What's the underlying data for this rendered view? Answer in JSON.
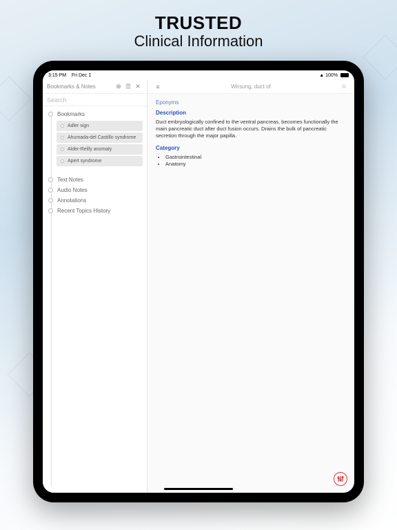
{
  "promo": {
    "line1": "TRUSTED",
    "line2": "Clinical Information"
  },
  "statusbar": {
    "time": "3:15 PM",
    "date": "Fri Dec 1",
    "battery": "100%",
    "wifi": "wifi-icon"
  },
  "sidebar": {
    "title": "Bookmarks & Notes",
    "icons": {
      "add": "plus-circle-icon",
      "sort": "filter-icon",
      "close": "close-icon"
    },
    "search_placeholder": "Search",
    "sections": {
      "bookmarks": {
        "label": "Bookmarks",
        "items": [
          {
            "label": "Adler sign"
          },
          {
            "label": "Ahumada-del Castillo syndrome"
          },
          {
            "label": "Alder-Reilly anomaly"
          },
          {
            "label": "Apert syndrome"
          }
        ]
      },
      "text_notes": {
        "label": "Text Notes"
      },
      "audio_notes": {
        "label": "Audio Notes"
      },
      "annotations": {
        "label": "Annotations"
      },
      "history": {
        "label": "Recent Topics History"
      }
    }
  },
  "main": {
    "toolbar": {
      "left_icon": "list-icon",
      "title": "Wirsung, duct of",
      "right_icon": "star-outline-icon"
    },
    "breadcrumb": "Eponyms",
    "description_heading": "Description",
    "description_body": "Duct embryologically confined to the ventral pancreas, becomes functionally the main pancreatic duct after duct fusion occurs. Drains the bulk of pancreatic secretion through the major papilla.",
    "category_heading": "Category",
    "categories": [
      "Gastrointestinal",
      "Anatomy"
    ],
    "fab": "settings-sliders-icon"
  }
}
